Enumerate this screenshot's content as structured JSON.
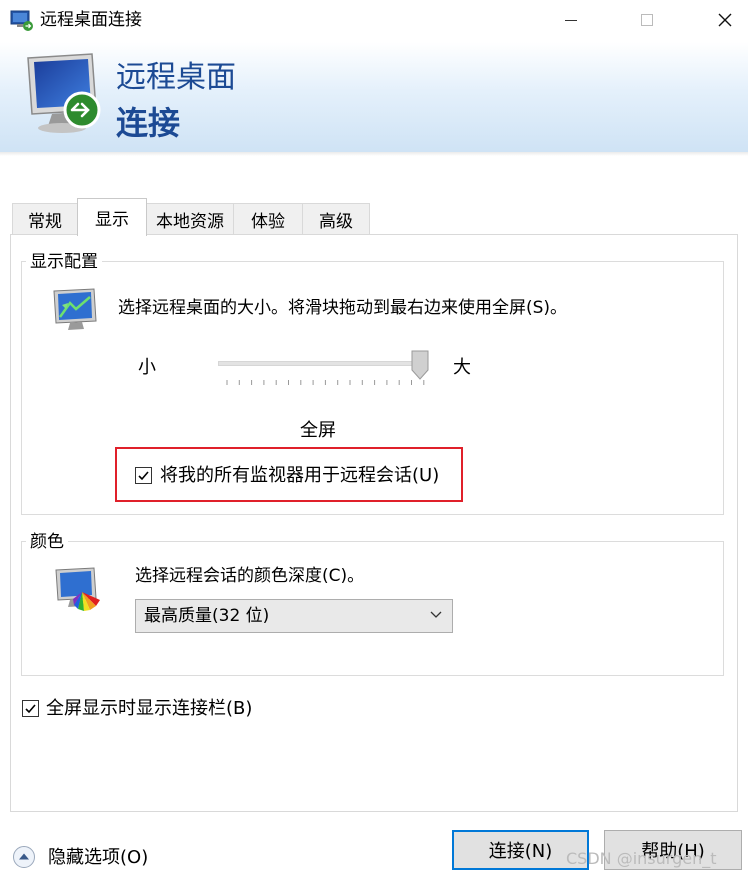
{
  "window": {
    "title": "远程桌面连接",
    "controls": {
      "minimize": "minimize",
      "maximize": "maximize",
      "close": "close"
    }
  },
  "banner": {
    "line1": "远程桌面",
    "line2": "连接"
  },
  "tabs": [
    {
      "label": "常规",
      "active": false
    },
    {
      "label": "显示",
      "active": true
    },
    {
      "label": "本地资源",
      "active": false
    },
    {
      "label": "体验",
      "active": false
    },
    {
      "label": "高级",
      "active": false
    }
  ],
  "display_config": {
    "group_label": "显示配置",
    "description": "选择远程桌面的大小。将滑块拖动到最右边来使用全屏(S)。",
    "slider": {
      "min_label": "小",
      "max_label": "大",
      "value": 1.0
    },
    "value_label": "全屏",
    "multimonitor": {
      "label": "将我的所有监视器用于远程会话(U)",
      "checked": true
    }
  },
  "color": {
    "group_label": "颜色",
    "description": "选择远程会话的颜色深度(C)。",
    "selected": "最高质量(32 位)"
  },
  "connection_bar": {
    "label": "全屏显示时显示连接栏(B)",
    "checked": true
  },
  "footer": {
    "hide_options": "隐藏选项(O)",
    "connect": "连接(N)",
    "help": "帮助(H)"
  },
  "watermark": "CSDN @insurgen_t",
  "colors": {
    "banner_text": "#1c4a94",
    "highlight": "#e0202a",
    "default_button_border": "#0078d7"
  }
}
